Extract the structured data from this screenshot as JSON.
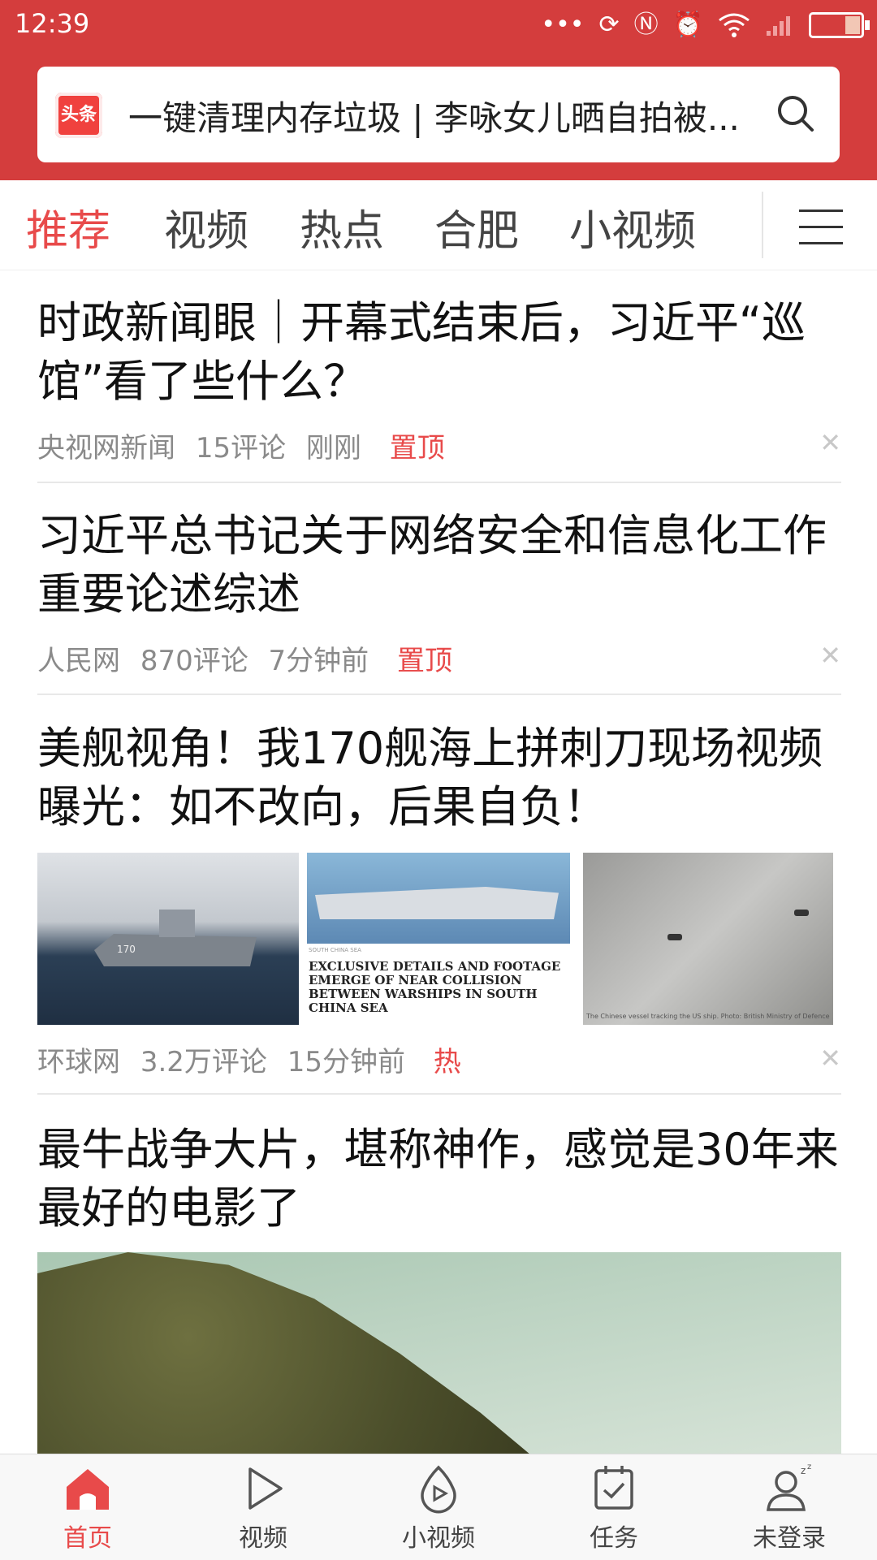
{
  "status_bar": {
    "time": "12:39"
  },
  "search": {
    "logo_text": "头条",
    "query": "一键清理内存垃圾 | 李咏女儿晒自拍被..."
  },
  "tabs": [
    "推荐",
    "视频",
    "热点",
    "合肥",
    "小视频"
  ],
  "feed": [
    {
      "title": "时政新闻眼｜开幕式结束后，习近平“巡馆”看了些什么？",
      "source": "央视网新闻",
      "comments": "15评论",
      "time": "刚刚",
      "tag": "置顶"
    },
    {
      "title": "习近平总书记关于网络安全和信息化工作重要论述综述",
      "source": "人民网",
      "comments": "870评论",
      "time": "7分钟前",
      "tag": "置顶"
    },
    {
      "title": "美舰视角！我170舰海上拼刺刀现场视频曝光：如不改向，后果自负！",
      "source": "环球网",
      "comments": "3.2万评论",
      "time": "15分钟前",
      "tag": "热",
      "image_text": {
        "ship_number": "170",
        "headline": "EXCLUSIVE DETAILS AND FOOTAGE EMERGE OF NEAR COLLISION BETWEEN WARSHIPS IN SOUTH CHINA SEA",
        "caption": "The Chinese vessel tracking the US ship. Photo: British Ministry of Defence"
      }
    },
    {
      "title": "最牛战争大片，堪称神作，感觉是30年来最好的电影了"
    }
  ],
  "bottom_nav": [
    {
      "label": "首页",
      "icon": "home-icon",
      "active": true
    },
    {
      "label": "视频",
      "icon": "play-icon"
    },
    {
      "label": "小视频",
      "icon": "short-video-icon"
    },
    {
      "label": "任务",
      "icon": "task-icon"
    },
    {
      "label": "未登录",
      "icon": "user-icon"
    }
  ],
  "colors": {
    "header": "#d43d3d",
    "accent": "#e84a4a"
  }
}
